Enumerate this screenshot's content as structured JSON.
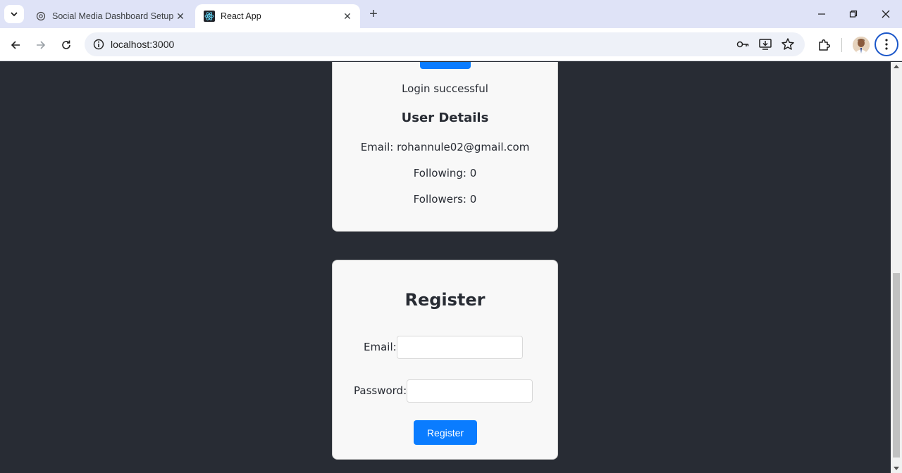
{
  "browser": {
    "tabs": [
      {
        "title": "Social Media Dashboard Setup",
        "favicon": "chatgpt-icon",
        "active": false
      },
      {
        "title": "React App",
        "favicon": "react-icon",
        "active": true
      }
    ],
    "new_tab_label": "+",
    "address": "localhost:3000"
  },
  "user_card": {
    "status_message": "Login successful",
    "details_heading": "User Details",
    "email_line": "Email: rohannule02@gmail.com",
    "following_line": "Following: 0",
    "followers_line": "Followers: 0"
  },
  "register_form": {
    "title": "Register",
    "email_label": "Email:",
    "email_value": "",
    "password_label": "Password:",
    "password_value": "",
    "submit_label": "Register"
  },
  "colors": {
    "page_background": "#282c34",
    "card_background": "#f8f8f8",
    "primary_button": "#0a7cff"
  }
}
